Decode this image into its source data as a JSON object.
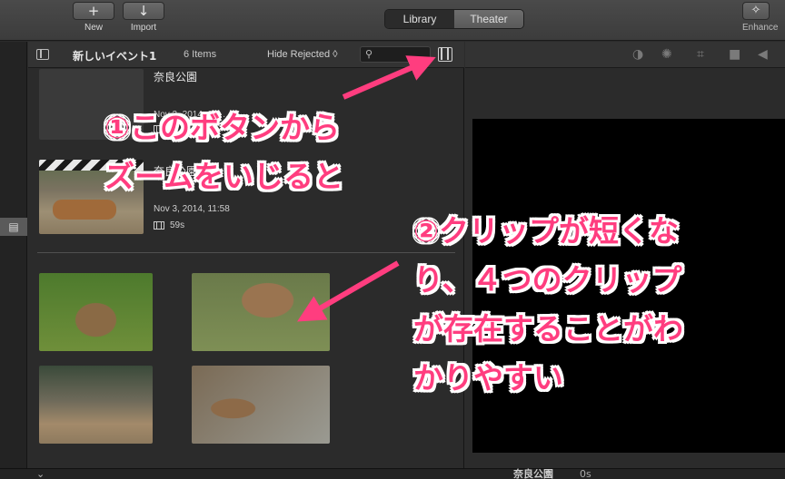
{
  "toolbar": {
    "new_label": "New",
    "import_label": "Import",
    "library_tab": "Library",
    "theater_tab": "Theater",
    "enhance_label": "Enhance"
  },
  "browser": {
    "event_title": "新しいイベント1",
    "item_count": "6 Items",
    "filter_label": "Hide Rejected ◊",
    "search_placeholder": "",
    "clips": [
      {
        "title": "奈良公園",
        "date": "Nov 3, 2014, 11:…"
      },
      {
        "title": "奈良公園",
        "date": "Nov 3, 2014, 11:58",
        "duration": "59s"
      }
    ]
  },
  "bottom": {
    "project_title": "奈良公園",
    "duration": "0s"
  },
  "annotations": {
    "note1": [
      "①このボタンから",
      "ズームをいじると"
    ],
    "note2": [
      "②クリップが短くな",
      "り、４つのクリップ",
      "が存在することがわ",
      "かりやすい"
    ]
  },
  "colors": {
    "annotation": "#ff3d7f",
    "background": "#2b2b2b",
    "viewer_screen": "#000000"
  },
  "icons": {
    "new": "plus-icon",
    "import": "down-arrow-icon",
    "enhance": "magic-wand-icon",
    "search": "search-icon",
    "clip_appearance": "filmstrip-icon"
  }
}
